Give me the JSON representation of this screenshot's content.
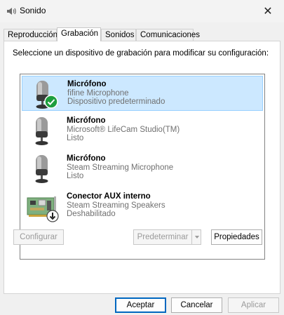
{
  "window": {
    "title": "Sonido",
    "close_symbol": "✕"
  },
  "tabs": [
    "Reproducción",
    "Grabación",
    "Sonidos",
    "Comunicaciones"
  ],
  "instruction": "Seleccione un dispositivo de grabación para modificar su configuración:",
  "devices": [
    {
      "name": "Micrófono",
      "model": "fifine Microphone",
      "status": "Dispositivo predeterminado",
      "icon": "microphone-icon",
      "badge": "check-badge-icon",
      "selected": true
    },
    {
      "name": "Micrófono",
      "model": "Microsoft® LifeCam Studio(TM)",
      "status": "Listo",
      "icon": "microphone-icon",
      "selected": false
    },
    {
      "name": "Micrófono",
      "model": "Steam Streaming Microphone",
      "status": "Listo",
      "icon": "microphone-icon",
      "selected": false
    },
    {
      "name": "Conector AUX interno",
      "model": "Steam Streaming Speakers",
      "status": "Deshabilitado",
      "icon": "sound-card-icon",
      "badge": "disabled-badge-icon",
      "selected": false
    }
  ],
  "buttons": {
    "configure": "Configurar",
    "set_default": "Predeterminar",
    "properties": "Propiedades",
    "ok": "Aceptar",
    "cancel": "Cancelar",
    "apply": "Aplicar"
  },
  "colors": {
    "selection": "#cce8ff",
    "selection_border": "#99d1ff",
    "accent": "#0067c0",
    "check": "#1e9e3e"
  }
}
